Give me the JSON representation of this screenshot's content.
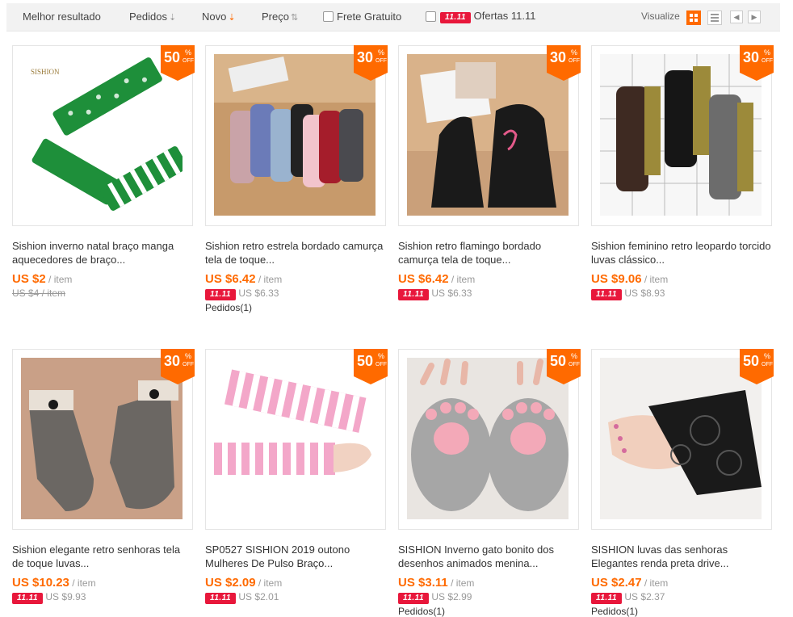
{
  "toolbar": {
    "best": "Melhor resultado",
    "orders": "Pedidos",
    "new": "Novo",
    "price": "Preço",
    "free_shipping": "Frete Gratuito",
    "badge": "11.11",
    "offers": "Ofertas 11.11",
    "visualize": "Visualize"
  },
  "products": [
    {
      "discount": "50",
      "pct": "%",
      "off": "OFF",
      "title": "Sishion inverno natal braço manga aquecedores de braço...",
      "price": "US $2",
      "unit": "/ item",
      "badge": "",
      "old": "US $4 / item",
      "orders": ""
    },
    {
      "discount": "30",
      "pct": "%",
      "off": "OFF",
      "title": "Sishion retro estrela bordado camurça tela de toque...",
      "price": "US $6.42",
      "unit": "/ item",
      "badge": "11.11",
      "old": "US $6.33",
      "orders": "Pedidos(1)"
    },
    {
      "discount": "30",
      "pct": "%",
      "off": "OFF",
      "title": "Sishion retro flamingo bordado camurça tela de toque...",
      "price": "US $6.42",
      "unit": "/ item",
      "badge": "11.11",
      "old": "US $6.33",
      "orders": ""
    },
    {
      "discount": "30",
      "pct": "%",
      "off": "OFF",
      "title": "Sishion feminino retro leopardo torcido luvas clássico...",
      "price": "US $9.06",
      "unit": "/ item",
      "badge": "11.11",
      "old": "US $8.93",
      "orders": ""
    },
    {
      "discount": "30",
      "pct": "%",
      "off": "OFF",
      "title": "Sishion elegante retro senhoras tela de toque luvas...",
      "price": "US $10.23",
      "unit": "/ item",
      "badge": "11.11",
      "old": "US $9.93",
      "orders": ""
    },
    {
      "discount": "50",
      "pct": "%",
      "off": "OFF",
      "title": "SP0527 SISHION 2019 outono Mulheres De Pulso Braço...",
      "price": "US $2.09",
      "unit": "/ item",
      "badge": "11.11",
      "old": "US $2.01",
      "orders": ""
    },
    {
      "discount": "50",
      "pct": "%",
      "off": "OFF",
      "title": "SISHION Inverno gato bonito dos desenhos animados menina...",
      "price": "US $3.11",
      "unit": "/ item",
      "badge": "11.11",
      "old": "US $2.99",
      "orders": "Pedidos(1)"
    },
    {
      "discount": "50",
      "pct": "%",
      "off": "OFF",
      "title": "SISHION luvas das senhoras Elegantes renda preta drive...",
      "price": "US $2.47",
      "unit": "/ item",
      "badge": "11.11",
      "old": "US $2.37",
      "orders": "Pedidos(1)"
    }
  ],
  "colors": {
    "accent": "#ff6a00",
    "badge": "#e8173b"
  },
  "icons": {
    "grid": "grid-view-icon",
    "list": "list-view-icon",
    "prev": "chevron-left-icon",
    "next": "chevron-right-icon"
  }
}
